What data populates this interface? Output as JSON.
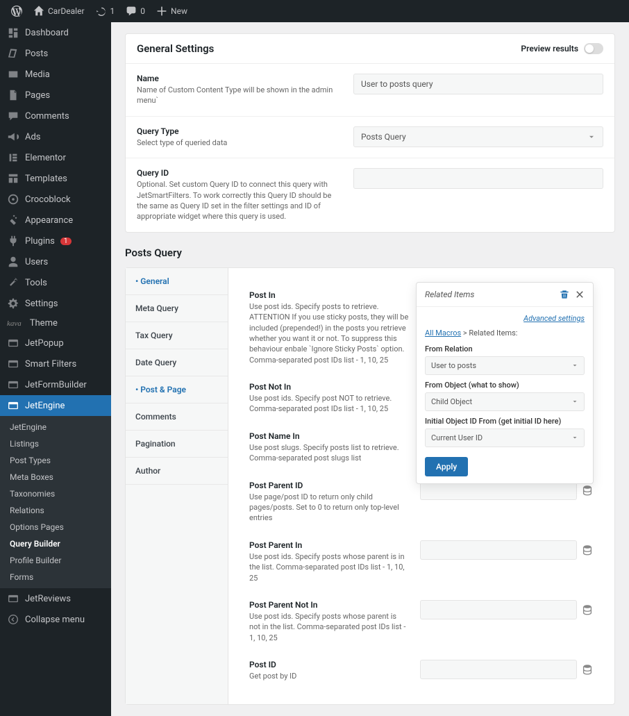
{
  "topbar": {
    "site": "CarDealer",
    "updates": "1",
    "comments": "0",
    "new": "New"
  },
  "sidebar": {
    "items": [
      {
        "key": "dashboard",
        "label": "Dashboard"
      },
      {
        "key": "posts",
        "label": "Posts"
      },
      {
        "key": "media",
        "label": "Media"
      },
      {
        "key": "pages",
        "label": "Pages"
      },
      {
        "key": "comments",
        "label": "Comments"
      },
      {
        "key": "ads",
        "label": "Ads"
      },
      {
        "key": "elementor",
        "label": "Elementor"
      },
      {
        "key": "templates",
        "label": "Templates"
      },
      {
        "key": "crocoblock",
        "label": "Crocoblock"
      },
      {
        "key": "appearance",
        "label": "Appearance"
      },
      {
        "key": "plugins",
        "label": "Plugins",
        "badge": "1"
      },
      {
        "key": "users",
        "label": "Users"
      },
      {
        "key": "tools",
        "label": "Tools"
      },
      {
        "key": "settings",
        "label": "Settings"
      },
      {
        "key": "theme",
        "label": "Theme",
        "prefix": "kava"
      },
      {
        "key": "jetpopup",
        "label": "JetPopup"
      },
      {
        "key": "smartfilters",
        "label": "Smart Filters"
      },
      {
        "key": "jetformbuilder",
        "label": "JetFormBuilder"
      },
      {
        "key": "jetengine",
        "label": "JetEngine",
        "active": true
      },
      {
        "key": "jetreviews",
        "label": "JetReviews"
      },
      {
        "key": "collapse",
        "label": "Collapse menu"
      }
    ],
    "sub": [
      {
        "label": "JetEngine"
      },
      {
        "label": "Listings"
      },
      {
        "label": "Post Types"
      },
      {
        "label": "Meta Boxes"
      },
      {
        "label": "Taxonomies"
      },
      {
        "label": "Relations"
      },
      {
        "label": "Options Pages"
      },
      {
        "label": "Query Builder",
        "current": true
      },
      {
        "label": "Profile Builder"
      },
      {
        "label": "Forms"
      }
    ]
  },
  "general": {
    "heading": "General Settings",
    "preview": "Preview results",
    "rows": [
      {
        "name": "Name",
        "desc": "Name of Custom Content Type will be shown in the admin menu`",
        "value": "User to posts query",
        "type": "text"
      },
      {
        "name": "Query Type",
        "desc": "Select type of queried data",
        "value": "Posts Query",
        "type": "select"
      },
      {
        "name": "Query ID",
        "desc": "Optional. Set custom Query ID to connect this query with JetSmartFilters. To work correctly this Query ID should be the same as Query ID set in the filter settings and ID of appropriate widget where this query is used.",
        "value": "",
        "type": "text"
      }
    ]
  },
  "postsQuery": {
    "heading": "Posts Query",
    "tabs": [
      {
        "label": "General",
        "active": true
      },
      {
        "label": "Meta Query"
      },
      {
        "label": "Tax Query"
      },
      {
        "label": "Date Query"
      },
      {
        "label": "Post & Page",
        "active": true
      },
      {
        "label": "Comments"
      },
      {
        "label": "Pagination"
      },
      {
        "label": "Author"
      }
    ],
    "fields": [
      {
        "name": "Post In",
        "desc": "Use post ids. Specify posts to retrieve. ATTENTION If you use sticky posts, they will be included (prepended!) in the posts you retrieve whether you want it or not. To suppress this behaviour enbale `Ignore Sticky Posts` option. Comma-separated post IDs list - 1, 10, 25"
      },
      {
        "name": "Post Not In",
        "desc": "Use post ids. Specify post NOT to retrieve. Comma-separated post IDs list - 1, 10, 25"
      },
      {
        "name": "Post Name In",
        "desc": "Use post slugs. Specify posts list to retrieve. Comma-separated post slugs list"
      },
      {
        "name": "Post Parent ID",
        "desc": "Use page/post ID to return only child pages/posts. Set to 0 to return only top-level entries"
      },
      {
        "name": "Post Parent In",
        "desc": "Use post ids. Specify posts whose parent is in the list. Comma-separated post IDs list - 1, 10, 25"
      },
      {
        "name": "Post Parent Not In",
        "desc": "Use post ids. Specify posts whose parent is not in the list. Comma-separated post IDs list - 1, 10, 25"
      },
      {
        "name": "Post ID",
        "desc": "Get post by ID"
      }
    ]
  },
  "popover": {
    "title": "Related Items",
    "advanced": "Advanced settings",
    "breadcrumb_root": "All Macros",
    "breadcrumb_current": "Related Items:",
    "fields": [
      {
        "label": "From Relation",
        "value": "User to posts"
      },
      {
        "label": "From Object (what to show)",
        "value": "Child Object"
      },
      {
        "label": "Initial Object ID From (get initial ID here)",
        "value": "Current User ID"
      }
    ],
    "apply": "Apply"
  }
}
